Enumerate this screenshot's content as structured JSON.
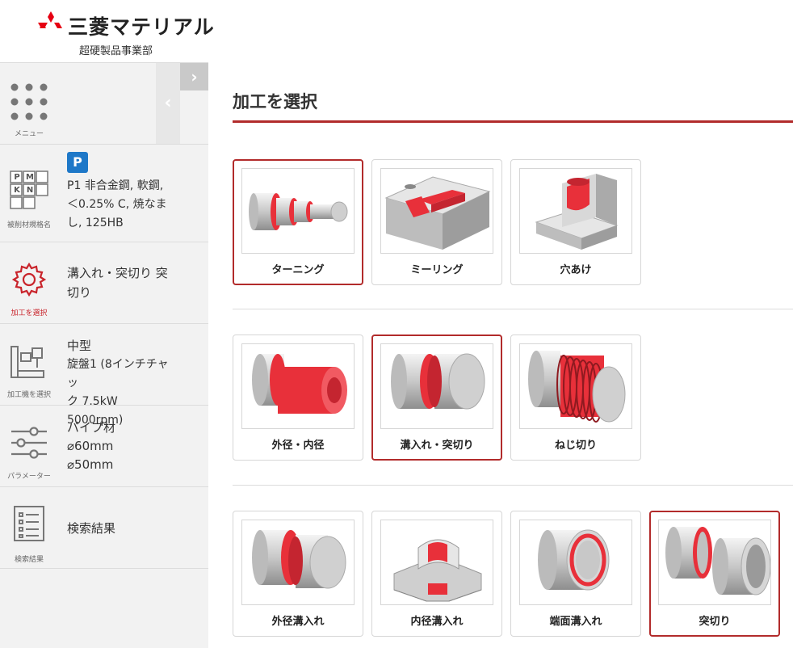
{
  "brand": {
    "name": "三菱マテリアル",
    "division": "超硬製品事業部"
  },
  "sidebar": {
    "menu": {
      "caption": "メニュー"
    },
    "material": {
      "caption": "被削材規格名",
      "grid_letters": [
        "P",
        "M",
        "K",
        "N"
      ],
      "badge": "P",
      "line1": "P1 非合金鋼, 軟鋼,",
      "line2": "＜0.25% C, 焼なま",
      "line3": "し, 125HB"
    },
    "process": {
      "caption": "加工を選択",
      "line1": "溝入れ・突切り 突",
      "line2": "切り"
    },
    "machine": {
      "caption": "加工機を選択",
      "line1": "中型",
      "line2": "旋盤1 (8インチチャッ",
      "line3": "ク 7.5kW 5000rpm)"
    },
    "parameters": {
      "caption": "パラメーター",
      "line1": "パイプ材",
      "line2": "⌀60mm",
      "line3": "⌀50mm"
    },
    "results": {
      "caption": "検索結果",
      "label": "検索結果"
    }
  },
  "main": {
    "title": "加工を選択",
    "row1": [
      {
        "label": "ターニング",
        "icon": "turning-icon",
        "selected": true
      },
      {
        "label": "ミーリング",
        "icon": "milling-icon",
        "selected": false
      },
      {
        "label": "穴あけ",
        "icon": "drilling-icon",
        "selected": false
      }
    ],
    "row2": [
      {
        "label": "外径・内径",
        "icon": "od-id-icon",
        "selected": false
      },
      {
        "label": "溝入れ・突切り",
        "icon": "grooving-parting-icon",
        "selected": true
      },
      {
        "label": "ねじ切り",
        "icon": "threading-icon",
        "selected": false
      }
    ],
    "row3": [
      {
        "label": "外径溝入れ",
        "icon": "od-grooving-icon",
        "selected": false
      },
      {
        "label": "内径溝入れ",
        "icon": "id-grooving-icon",
        "selected": false
      },
      {
        "label": "端面溝入れ",
        "icon": "face-grooving-icon",
        "selected": false
      },
      {
        "label": "突切り",
        "icon": "parting-off-icon",
        "selected": true
      }
    ]
  },
  "colors": {
    "accent": "#b22b2b",
    "highlight": "#e8303a",
    "badge": "#1e78c8",
    "sidebar_bg": "#f2f2f2"
  }
}
